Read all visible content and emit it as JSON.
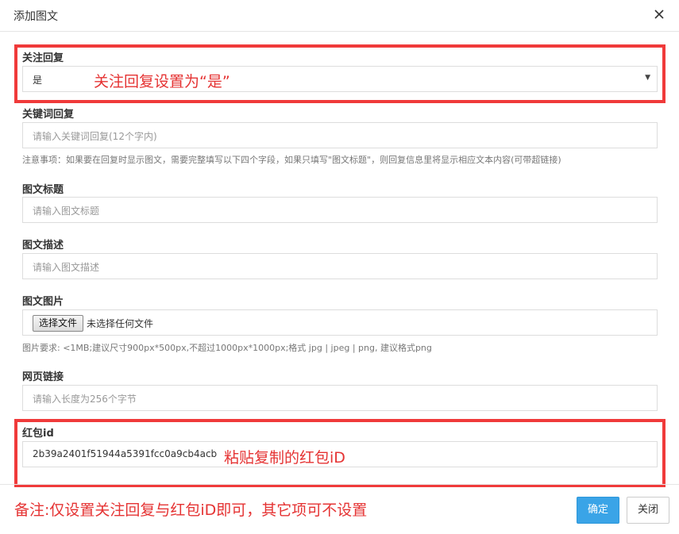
{
  "dialog": {
    "title": "添加图文",
    "close_icon": "close-icon"
  },
  "follow_reply": {
    "label": "关注回复",
    "selected": "是",
    "annotation": "关注回复设置为“是”"
  },
  "keyword_reply": {
    "label": "关键词回复",
    "placeholder": "请输入关键词回复(12个字内)",
    "note": "注意事项：如果要在回复时显示图文，需要完整填写以下四个字段，如果只填写\"图文标题\"，则回复信息里将显示相应文本内容(可带超链接)"
  },
  "article_title": {
    "label": "图文标题",
    "placeholder": "请输入图文标题"
  },
  "article_desc": {
    "label": "图文描述",
    "placeholder": "请输入图文描述"
  },
  "article_image": {
    "label": "图文图片",
    "button": "选择文件",
    "status": "未选择任何文件",
    "note": "图片要求: <1MB;建议尺寸900px*500px,不超过1000px*1000px;格式 jpg | jpeg | png, 建议格式png"
  },
  "web_link": {
    "label": "网页链接",
    "placeholder": "请输入长度为256个字节"
  },
  "redpacket": {
    "label": "红包id",
    "value": "2b39a2401f51944a5391fcc0a9cb4acb",
    "annotation": "粘贴复制的红包iD"
  },
  "footer": {
    "remark": "备注:仅设置关注回复与红包iD即可，其它项可不设置",
    "confirm": "确定",
    "close": "关闭"
  },
  "colors": {
    "primary": "#3aa4e7",
    "annotation_red": "#e53333"
  }
}
